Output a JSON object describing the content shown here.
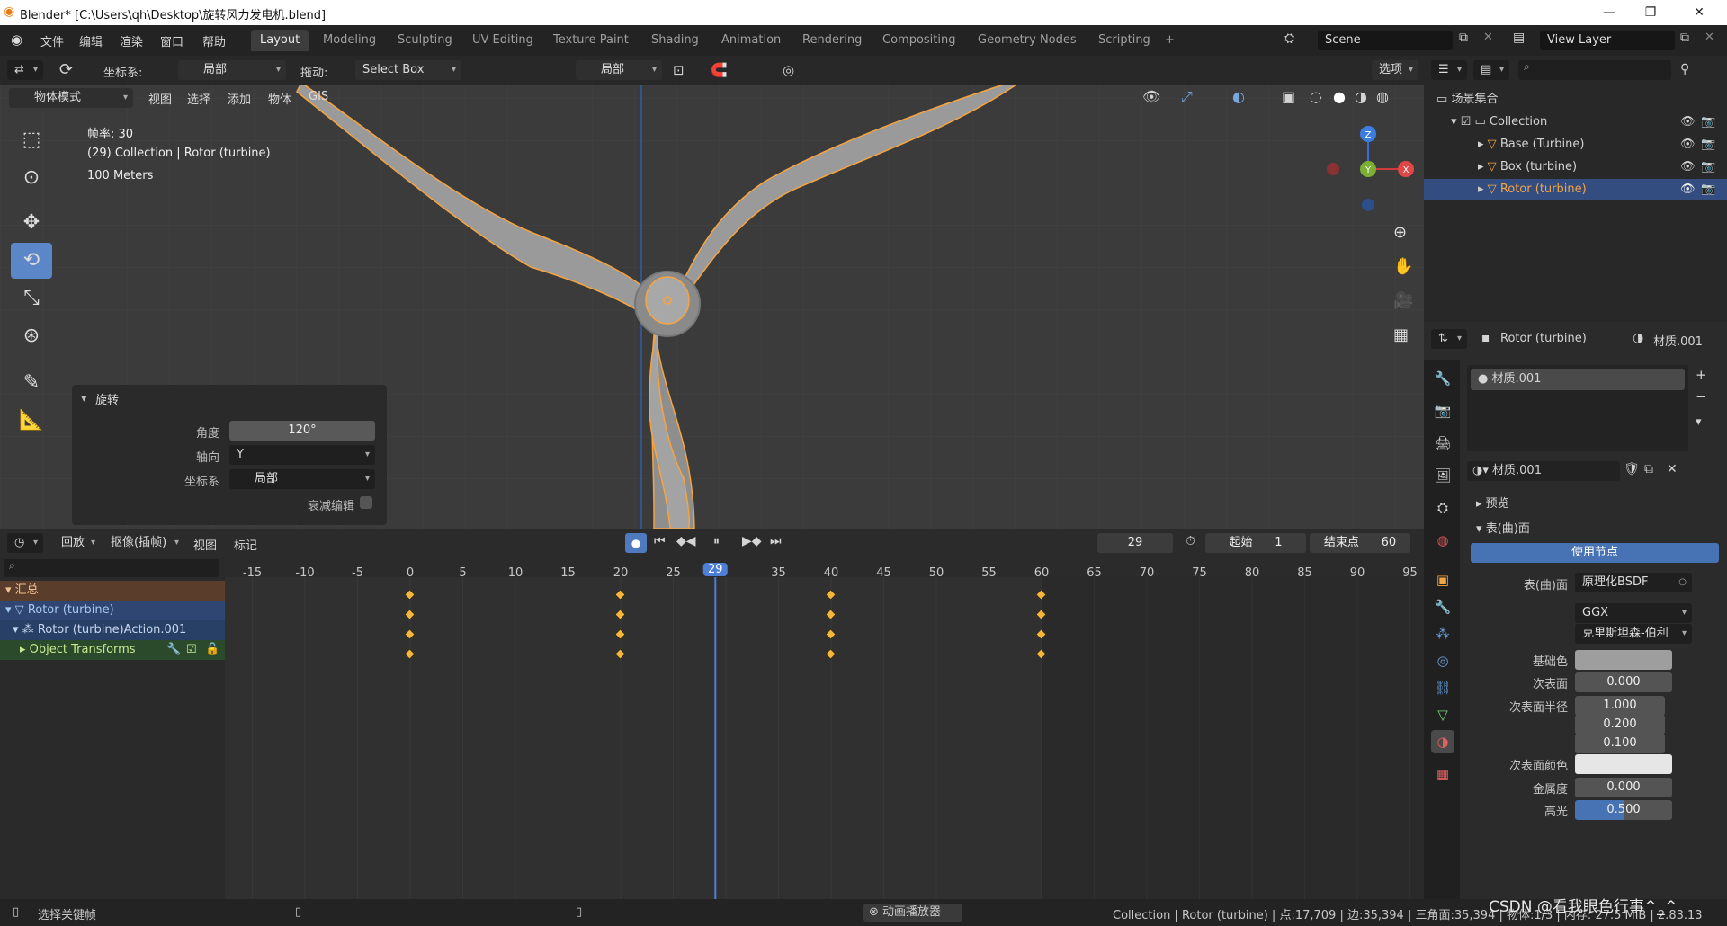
{
  "titlebar": {
    "title": "Blender* [C:\\Users\\qh\\Desktop\\旋转风力发电机.blend]"
  },
  "menu": {
    "items": [
      "文件",
      "编辑",
      "渲染",
      "窗口",
      "帮助"
    ]
  },
  "workspaces": {
    "tabs": [
      "Layout",
      "Modeling",
      "Sculpting",
      "UV Editing",
      "Texture Paint",
      "Shading",
      "Animation",
      "Rendering",
      "Compositing",
      "Geometry Nodes",
      "Scripting",
      "+"
    ],
    "active": "Layout"
  },
  "scene": {
    "name": "Scene",
    "view_layer": "View Layer"
  },
  "vp_header": {
    "coord_label": "坐标系:",
    "coord_value": "局部",
    "drag_label": "拖动:",
    "drag_value": "Select Box",
    "pivot_value": "局部",
    "options": "选项"
  },
  "vp_menu": {
    "mode": "物体模式",
    "items": [
      "视图",
      "选择",
      "添加",
      "物体",
      "GIS"
    ]
  },
  "vp_overlay": {
    "fps": "帧率: 30",
    "collection": "(29) Collection | Rotor (turbine)",
    "scale": "100 Meters"
  },
  "redo_panel": {
    "title": "旋转",
    "angle_label": "角度",
    "angle_value": "120°",
    "axis_label": "轴向",
    "axis_value": "Y",
    "coord_label": "坐标系",
    "coord_value": "局部",
    "proportional_label": "衰减编辑"
  },
  "gizmo": {
    "z": "Z",
    "y": "Y",
    "x": "X"
  },
  "timeline_header": {
    "playback": "回放",
    "keying": "抠像(插帧)",
    "view": "视图",
    "marker": "标记",
    "current_frame": "29",
    "start_label": "起始",
    "start_value": "1",
    "end_label": "结束点",
    "end_value": "60"
  },
  "timeline": {
    "ruler": [
      "-15",
      "-10",
      "-5",
      "0",
      "5",
      "10",
      "15",
      "20",
      "25",
      "29",
      "35",
      "40",
      "45",
      "50",
      "55",
      "60",
      "65",
      "70",
      "75",
      "80",
      "85",
      "90",
      "95"
    ],
    "keyframes": [
      0,
      20,
      40,
      60
    ],
    "current": 29
  },
  "channels": {
    "summary": "汇总",
    "object": "Rotor (turbine)",
    "action": "Rotor (turbine)Action.001",
    "group": "Object Transforms"
  },
  "outliner": {
    "root": "场景集合",
    "collection": "Collection",
    "items": [
      "Base (Turbine)",
      "Box (turbine)",
      "Rotor (turbine)"
    ]
  },
  "properties": {
    "object_name": "Rotor (turbine)",
    "material_name": "材质.001",
    "slot": "材质.001",
    "material_field": "材质.001",
    "preview": "预览",
    "surface": "表(曲)面",
    "use_nodes": "使用节点",
    "surface_label": "表(曲)面",
    "surface_value": "原理化BSDF",
    "distribution": "GGX",
    "subsurface_method": "克里斯坦森-伯利",
    "base_color_label": "基础色",
    "base_color": "#9e9e9e",
    "subsurface_label": "次表面",
    "subsurface_value": "0.000",
    "subsurface_radius_label": "次表面半径",
    "radius": [
      "1.000",
      "0.200",
      "0.100"
    ],
    "subsurface_color_label": "次表面颜色",
    "subsurface_color": "#e6e6e6",
    "metallic_label": "金属度",
    "metallic_value": "0.000",
    "specular_label": "高光",
    "specular_value": "0.500"
  },
  "statusbar": {
    "left": "选择关键帧",
    "center": "动画播放器",
    "right": "Collection | Rotor (turbine) | 点:17,709 | 边:35,394 | 三角面:35,394 | 物体:1/3 | 内存: 27.5 MiB | 2.83.13",
    "watermark": "CSDN @看我眼色行事^_^"
  },
  "colors": {
    "accent": "#5b86c8",
    "select_orange": "#f5a442",
    "keyframe": "#f5b73b"
  }
}
